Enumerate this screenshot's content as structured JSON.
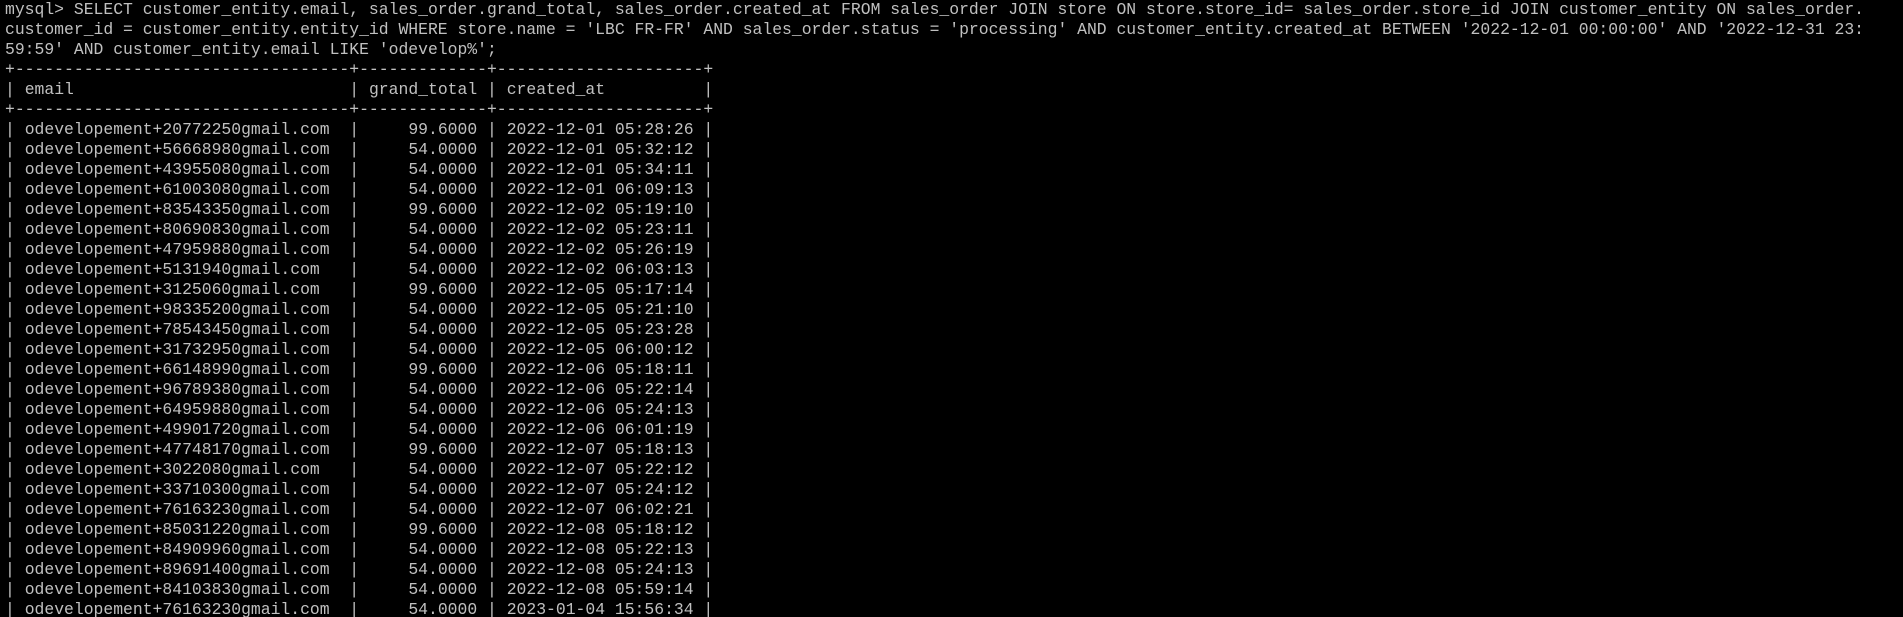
{
  "terminal": {
    "theme": {
      "background": "#000000",
      "foreground": "#c0c0c0"
    },
    "query_lines": [
      "mysql> SELECT customer_entity.email, sales_order.grand_total, sales_order.created_at FROM sales_order JOIN store ON store.store_id= sales_order.store_id JOIN customer_entity ON sales_order.",
      "customer_id = customer_entity.entity_id WHERE store.name = 'LBC FR-FR' AND sales_order.status = 'processing' AND customer_entity.created_at BETWEEN '2022-12-01 00:00:00' AND '2022-12-31 23:",
      "59:59' AND customer_entity.email LIKE 'odevelop%';"
    ],
    "result": {
      "columns": [
        "email",
        "grand_total",
        "created_at"
      ],
      "rows": [
        [
          "odevelopement+20772250gmail.com",
          "99.6000",
          "2022-12-01 05:28:26"
        ],
        [
          "odevelopement+56668980gmail.com",
          "54.0000",
          "2022-12-01 05:32:12"
        ],
        [
          "odevelopement+43955080gmail.com",
          "54.0000",
          "2022-12-01 05:34:11"
        ],
        [
          "odevelopement+61003080gmail.com",
          "54.0000",
          "2022-12-01 06:09:13"
        ],
        [
          "odevelopement+83543350gmail.com",
          "99.6000",
          "2022-12-02 05:19:10"
        ],
        [
          "odevelopement+80690830gmail.com",
          "54.0000",
          "2022-12-02 05:23:11"
        ],
        [
          "odevelopement+47959880gmail.com",
          "54.0000",
          "2022-12-02 05:26:19"
        ],
        [
          "odevelopement+5131940gmail.com",
          "54.0000",
          "2022-12-02 06:03:13"
        ],
        [
          "odevelopement+3125060gmail.com",
          "99.6000",
          "2022-12-05 05:17:14"
        ],
        [
          "odevelopement+98335200gmail.com",
          "54.0000",
          "2022-12-05 05:21:10"
        ],
        [
          "odevelopement+78543450gmail.com",
          "54.0000",
          "2022-12-05 05:23:28"
        ],
        [
          "odevelopement+31732950gmail.com",
          "54.0000",
          "2022-12-05 06:00:12"
        ],
        [
          "odevelopement+66148990gmail.com",
          "99.6000",
          "2022-12-06 05:18:11"
        ],
        [
          "odevelopement+96789380gmail.com",
          "54.0000",
          "2022-12-06 05:22:14"
        ],
        [
          "odevelopement+64959880gmail.com",
          "54.0000",
          "2022-12-06 05:24:13"
        ],
        [
          "odevelopement+49901720gmail.com",
          "54.0000",
          "2022-12-06 06:01:19"
        ],
        [
          "odevelopement+47748170gmail.com",
          "99.6000",
          "2022-12-07 05:18:13"
        ],
        [
          "odevelopement+3022080gmail.com",
          "54.0000",
          "2022-12-07 05:22:12"
        ],
        [
          "odevelopement+33710300gmail.com",
          "54.0000",
          "2022-12-07 05:24:12"
        ],
        [
          "odevelopement+76163230gmail.com",
          "54.0000",
          "2022-12-07 06:02:21"
        ],
        [
          "odevelopement+85031220gmail.com",
          "99.6000",
          "2022-12-08 05:18:12"
        ],
        [
          "odevelopement+84909960gmail.com",
          "54.0000",
          "2022-12-08 05:22:13"
        ],
        [
          "odevelopement+89691400gmail.com",
          "54.0000",
          "2022-12-08 05:24:13"
        ],
        [
          "odevelopement+84103830gmail.com",
          "54.0000",
          "2022-12-08 05:59:14"
        ],
        [
          "odevelopement+76163230gmail.com",
          "54.0000",
          "2023-01-04 15:56:34"
        ]
      ]
    }
  }
}
